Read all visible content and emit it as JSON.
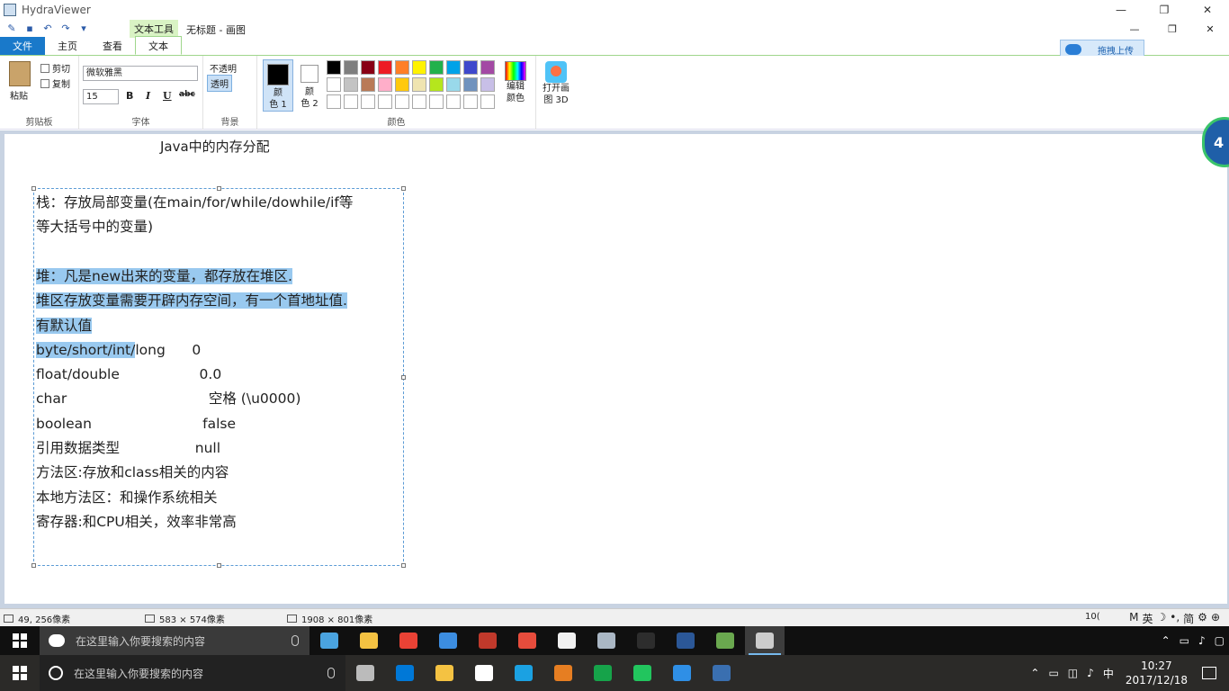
{
  "window": {
    "title": "HydraViewer",
    "minimize": "—",
    "restore": "❐",
    "close": "✕"
  },
  "inner": {
    "context_tab": "文本工具",
    "doc_title": "无标题 - 画图",
    "minimize": "—",
    "restore": "❐",
    "close": "✕"
  },
  "tabs": [
    "文件",
    "主页",
    "查看",
    "文本"
  ],
  "upload": {
    "label": "拖拽上传"
  },
  "ribbon": {
    "clipboard": {
      "paste": "粘贴",
      "cut": "剪切",
      "copy": "复制",
      "label": "剪贴板"
    },
    "font": {
      "family": "微软雅黑",
      "size": "15",
      "bold": "B",
      "italic": "I",
      "underline": "U",
      "strike": "abc",
      "label": "字体"
    },
    "background": {
      "opaque": "不透明",
      "transparent": "透明",
      "label": "背景"
    },
    "colors": {
      "color1": "颜\n色 1",
      "color2": "颜\n色 2",
      "edit": "编辑\n颜色",
      "label": "颜色"
    },
    "paint3d": "打开画\n图 3D",
    "palette": [
      "#000000",
      "#7f7f7f",
      "#880015",
      "#ed1c24",
      "#ff7f27",
      "#fff200",
      "#22b14c",
      "#00a2e8",
      "#3f48cc",
      "#a349a4",
      "#ffffff",
      "#c3c3c3",
      "#b97a57",
      "#ffaec9",
      "#ffc90e",
      "#efe4b0",
      "#b5e61d",
      "#99d9ea",
      "#7092be",
      "#c8bfe7",
      "#ffffff",
      "#ffffff",
      "#ffffff",
      "#ffffff",
      "#ffffff",
      "#ffffff",
      "#ffffff",
      "#ffffff",
      "#ffffff",
      "#ffffff"
    ]
  },
  "document": {
    "heading": "Java中的内存分配",
    "lines": [
      "栈：存放局部变量(在main/for/while/dowhile/if等",
      "等大括号中的变量)",
      "",
      "堆：凡是new出来的变量，都存放在堆区.",
      "堆区存放变量需要开辟内存空间，有一个首地址值.",
      "有默认值",
      "byte/short/int/long      0",
      "float/double                  0.0",
      "char                                空格 (\\u0000)",
      "boolean                         false",
      "引用数据类型                 null",
      "方法区:存放和class相关的内容",
      "本地方法区：和操作系统相关",
      "寄存器:和CPU相关，效率非常高"
    ],
    "side_badge": "4"
  },
  "status": {
    "cursor": "49, 256像素",
    "selection": "583 × 574像素",
    "canvas_size": "1908 × 801像素",
    "zoom": "10(",
    "ime": [
      "M",
      "英",
      "☽",
      "•,",
      "简",
      "⚙",
      "⊕"
    ]
  },
  "taskbar1": {
    "search_placeholder": "在这里输入你要搜索的内容",
    "icons": [
      "#4aa3df",
      "#f4c242",
      "#e94235",
      "#3c8de0",
      "#c0392b",
      "#e74c3c",
      "#f0f0f0",
      "#aab7c4",
      "#2d2d2d",
      "#2b5797",
      "#6aa84f",
      "#cccccc"
    ]
  },
  "taskbar2": {
    "search_placeholder": "在这里输入你要搜索的内容",
    "time": "10:27",
    "date": "2017/12/18",
    "ime": "中",
    "icons": [
      "#bbbbbb",
      "#0078d7",
      "#f4c242",
      "#ffffff",
      "#1ba1e2",
      "#e67e22",
      "#16a34a",
      "#22c55e",
      "#2f8fe6",
      "#3a6fb0"
    ]
  }
}
